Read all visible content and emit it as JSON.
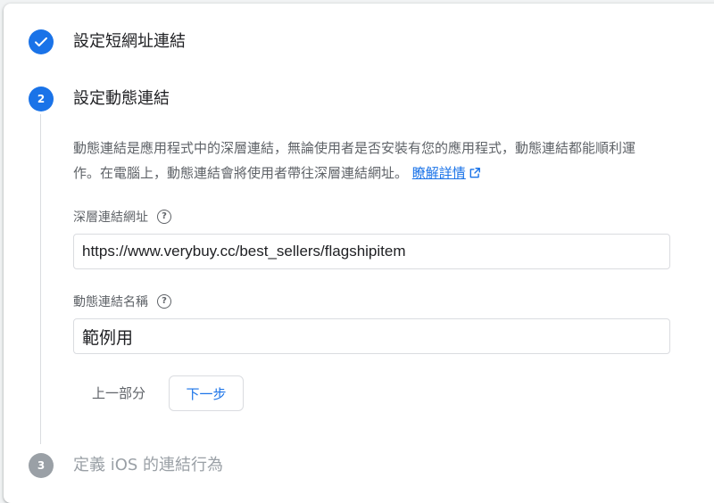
{
  "steps": [
    {
      "number": "",
      "title": "設定短網址連結",
      "state": "done"
    },
    {
      "number": "2",
      "title": "設定動態連結",
      "state": "active"
    },
    {
      "number": "3",
      "title": "定義 iOS 的連結行為",
      "state": "inactive"
    }
  ],
  "description": {
    "line1": "動態連結是應用程式中的深層連結，無論使用者是否安裝有您的應用程式，動態連結都能順利運",
    "line2": "作。在電腦上，動態連結會將使用者帶往深層連結網址。",
    "learn_more": "瞭解詳情"
  },
  "deep_link": {
    "label": "深層連結網址",
    "value": "https://www.verybuy.cc/best_sellers/flagshipitem"
  },
  "link_name": {
    "label": "動態連結名稱",
    "value": "範例用"
  },
  "buttons": {
    "previous": "上一部分",
    "next": "下一步"
  },
  "colors": {
    "accent": "#1a73e8",
    "inactive_step": "#9aa0a6"
  },
  "icons": [
    "check-icon",
    "help-icon",
    "external-link-icon"
  ]
}
